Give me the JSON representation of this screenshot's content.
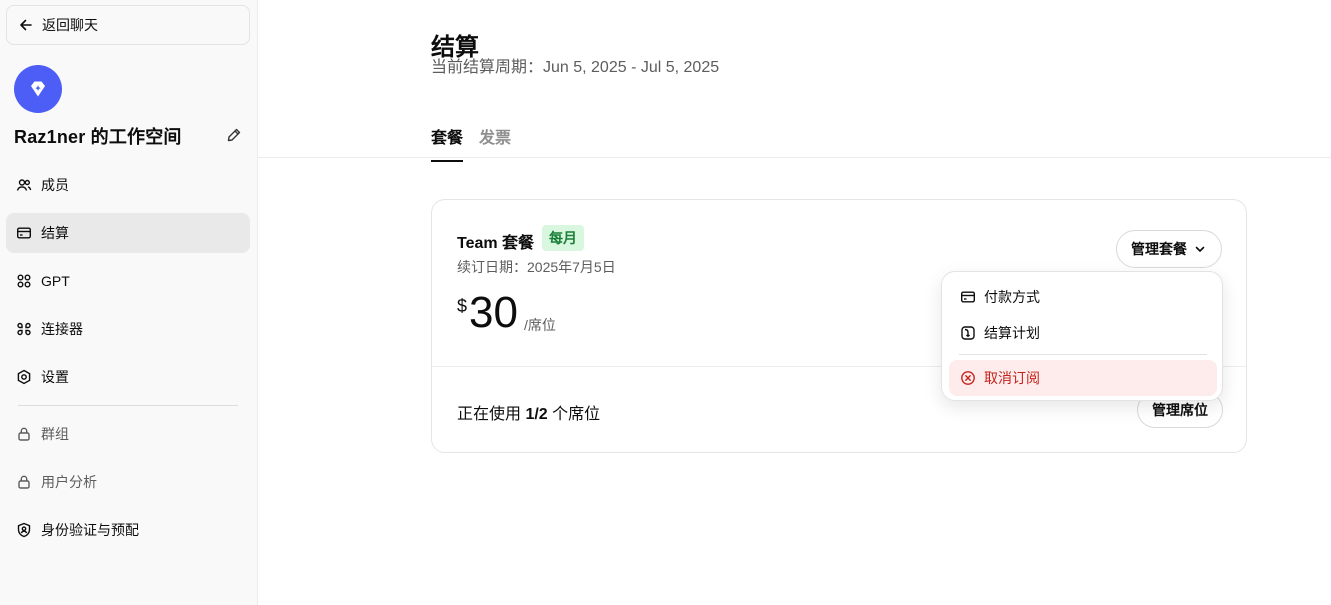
{
  "sidebar": {
    "back_label": "返回聊天",
    "workspace_name": "Raz1ner 的工作空间",
    "items": [
      {
        "label": "成员"
      },
      {
        "label": "结算"
      },
      {
        "label": "GPT"
      },
      {
        "label": "连接器"
      },
      {
        "label": "设置"
      },
      {
        "label": "群组"
      },
      {
        "label": "用户分析"
      },
      {
        "label": "身份验证与预配"
      }
    ]
  },
  "main": {
    "title": "结算",
    "period": "当前结算周期：Jun 5, 2025 - Jul 5, 2025",
    "tabs": [
      {
        "label": "套餐",
        "active": true
      },
      {
        "label": "发票",
        "active": false
      }
    ]
  },
  "plan": {
    "name": "Team 套餐",
    "badge": "每月",
    "renewal": "续订日期：2025年7月5日",
    "currency": "$",
    "amount": "30",
    "unit": "/席位",
    "manage_label": "管理套餐",
    "seats_prefix": "正在使用 ",
    "seats_value": "1/2",
    "seats_suffix": " 个席位",
    "manage_seats_label": "管理席位"
  },
  "dropdown": {
    "items": [
      {
        "label": "付款方式",
        "icon": "credit-card-icon"
      },
      {
        "label": "结算计划",
        "icon": "billing-plan-icon"
      },
      {
        "label": "取消订阅",
        "icon": "cancel-circle-icon"
      }
    ]
  },
  "colors": {
    "accent": "#4d5ef6",
    "badge_bg": "#d9f7df",
    "badge_text": "#1a7f37",
    "danger": "#c4221b",
    "danger_bg": "#fdeceb"
  }
}
